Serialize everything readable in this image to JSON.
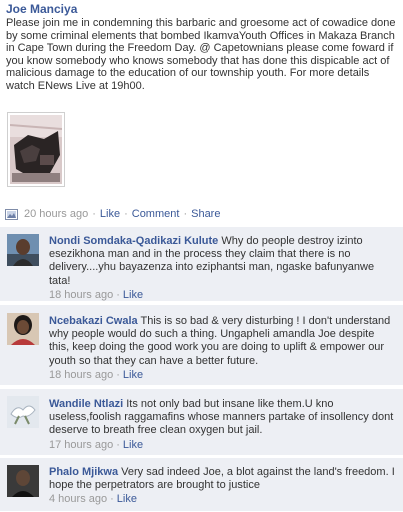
{
  "post": {
    "author": "Joe Manciya",
    "message": "Please join me in condemning this barbaric and groesome act of cowadice done by some criminal elements that bombed IkamvaYouth Offices in Makaza Branch in Cape Town during the Freedom Day. @ Capetownians please come foward if you know somebody who knows somebody that has done this dispicable act of malicious damage to the education of our township youth. For more details watch ENews Live at 19h00.",
    "time": "20 hours ago",
    "separator": "·",
    "actions": {
      "like": "Like",
      "comment": "Comment",
      "share": "Share"
    }
  },
  "comments": [
    {
      "name": "Nondi Somdaka-Qadikazi Kulute",
      "text": "Why do people destroy izinto esezikhona man and in the process they claim that there is no delivery....yhu bayazenza into eziphantsi man, ngaske bafunyanwe tata!",
      "time": "18 hours ago",
      "like": "Like"
    },
    {
      "name": "Ncebakazi Cwala",
      "text": "This is so bad & very disturbing ! I don't understand why people would do such a thing. Ungapheli amandla Joe despite this, keep doing the good work you are doing to uplift & empower our youth so that they can have a better future.",
      "time": "18 hours ago",
      "like": "Like"
    },
    {
      "name": "Wandile Ntlazi",
      "text": "Its not only bad but insane like them.U kno useless,foolish raggamafins whose manners partake of insollency dont deserve to breath free clean oxygen but jail.",
      "time": "17 hours ago",
      "like": "Like"
    },
    {
      "name": "Phalo Mjikwa",
      "text": "Very sad indeed Joe, a blot against the land's freedom. I hope the perpetrators are brought to justice",
      "time": "4 hours ago",
      "like": "Like"
    }
  ],
  "colors": {
    "link": "#3b5998",
    "comment_bg": "#edeff4",
    "meta": "#999999"
  },
  "icons": {
    "post_type": "photo-icon"
  }
}
